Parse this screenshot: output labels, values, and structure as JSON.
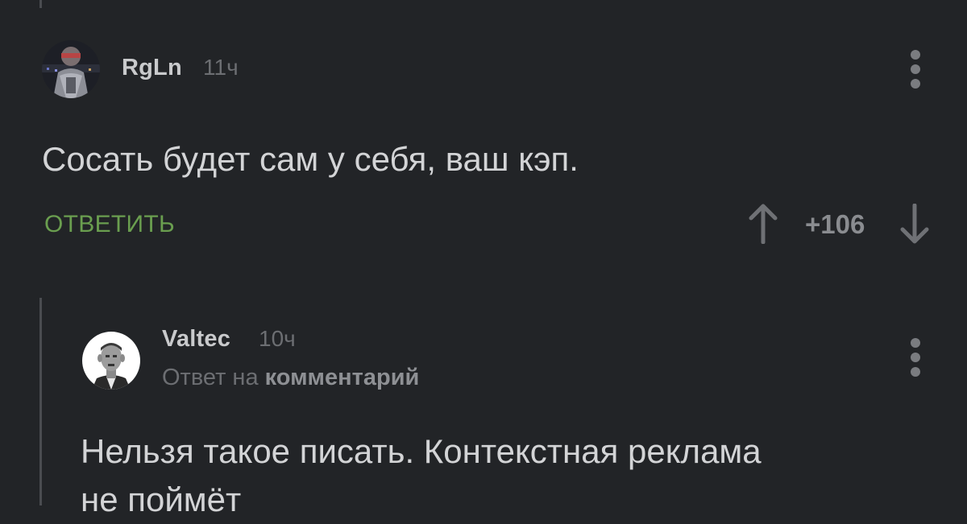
{
  "comments": [
    {
      "author": "RgLn",
      "time": "11ч",
      "text": "Сосать будет сам у себя, ваш кэп.",
      "reply_label": "ОТВЕТИТЬ",
      "rating": "+106",
      "avatar_icon": "robocop-avatar"
    },
    {
      "author": "Valtec",
      "time": "10ч",
      "reply_prefix": "Ответ на",
      "reply_target": "комментарий",
      "text_line1": "Нельзя такое писать. Контекстная реклама",
      "text_line2": "не поймёт",
      "avatar_icon": "portrait-avatar"
    }
  ],
  "colors": {
    "background": "#222427",
    "reply_green": "#6a9e4f",
    "muted": "#6c6e72"
  }
}
